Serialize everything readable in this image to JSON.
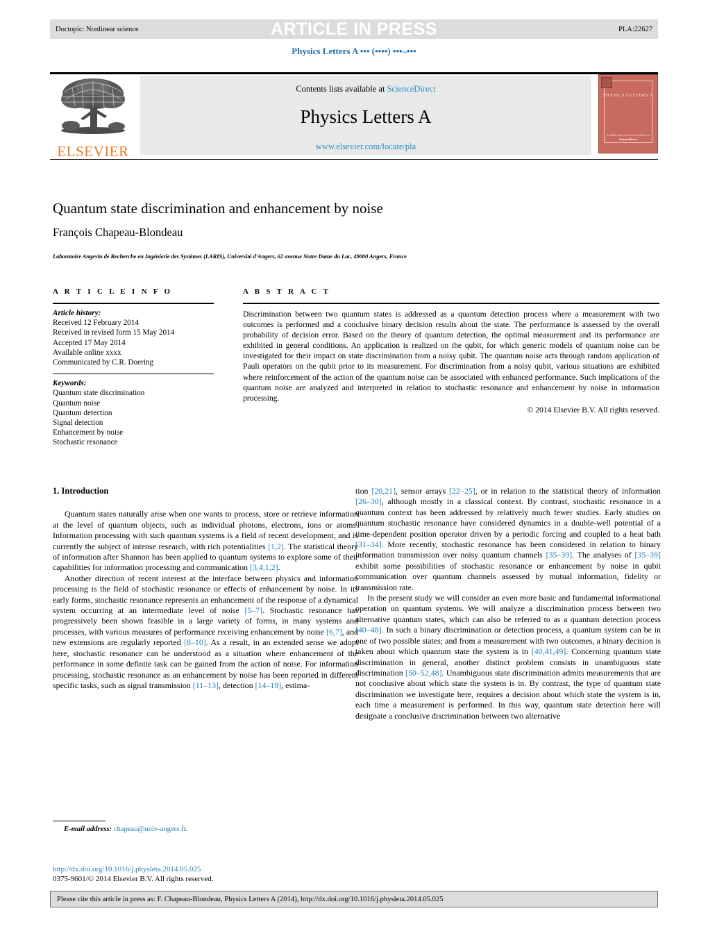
{
  "header": {
    "doctopic": "Doctopic: Nonlinear science",
    "banner": "ARTICLE IN PRESS",
    "article_code": "PLA:22627",
    "journal_ref": "Physics Letters A ••• (••••) •••–•••"
  },
  "masthead": {
    "publisher": "ELSEVIER",
    "contents_prefix": "Contents lists available at",
    "contents_link": "ScienceDirect",
    "journal_title": "Physics Letters A",
    "journal_url": "www.elsevier.com/locate/pla",
    "cover_title": "PHYSICS LETTERS A",
    "cover_footer_small": "Available online at www.sciencedirect.com",
    "cover_footer_bold": "ScienceDirect"
  },
  "title_block": {
    "title": "Quantum state discrimination and enhancement by noise",
    "author": "François Chapeau-Blondeau",
    "affiliation": "Laboratoire Angevin de Recherche en Ingénierie des Systèmes (LARIS), Université d'Angers, 62 avenue Notre Dame du Lac, 49000 Angers, France"
  },
  "article_info": {
    "heading": "A R T I C L E    I N F O",
    "history_label": "Article history:",
    "history": [
      "Received 12 February 2014",
      "Received in revised form 15 May 2014",
      "Accepted 17 May 2014",
      "Available online xxxx",
      "Communicated by C.R. Doering"
    ],
    "keywords_label": "Keywords:",
    "keywords": [
      "Quantum state discrimination",
      "Quantum noise",
      "Quantum detection",
      "Signal detection",
      "Enhancement by noise",
      "Stochastic resonance"
    ]
  },
  "abstract": {
    "heading": "A B S T R A C T",
    "text": "Discrimination between two quantum states is addressed as a quantum detection process where a measurement with two outcomes is performed and a conclusive binary decision results about the state. The performance is assessed by the overall probability of decision error. Based on the theory of quantum detection, the optimal measurement and its performance are exhibited in general conditions. An application is realized on the qubit, for which generic models of quantum noise can be investigated for their impact on state discrimination from a noisy qubit. The quantum noise acts through random application of Pauli operators on the qubit prior to its measurement. For discrimination from a noisy qubit, various situations are exhibited where reinforcement of the action of the quantum noise can be associated with enhanced performance. Such implications of the quantum noise are analyzed and interpreted in relation to stochastic resonance and enhancement by noise in information processing.",
    "copyright": "© 2014 Elsevier B.V. All rights reserved."
  },
  "body": {
    "section_title": "1. Introduction",
    "left_paragraphs": [
      "Quantum states naturally arise when one wants to process, store or retrieve information at the level of quantum objects, such as individual photons, electrons, ions or atoms. Information processing with such quantum systems is a field of recent development, and is currently the subject of intense research, with rich potentialities [1,2]. The statistical theory of information after Shannon has been applied to quantum systems to explore some of their capabilities for information processing and communication [3,4,1,2].",
      "Another direction of recent interest at the interface between physics and information processing is the field of stochastic resonance or effects of enhancement by noise. In its early forms, stochastic resonance represents an enhancement of the response of a dynamical system occurring at an intermediate level of noise [5–7]. Stochastic resonance has progressively been shown feasible in a large variety of forms, in many systems and processes, with various measures of performance receiving enhancement by noise [6,7], and new extensions are regularly reported [8–10]. As a result, in an extended sense we adopt here, stochastic resonance can be understood as a situation where enhancement of the performance in some definite task can be gained from the action of noise. For information processing, stochastic resonance as an enhancement by noise has been reported in different specific tasks, such as signal transmission [11–13], detection [14–19], estima-"
    ],
    "right_paragraphs": [
      "tion [20,21], sensor arrays [22–25], or in relation to the statistical theory of information [26–30], although mostly in a classical context. By contrast, stochastic resonance in a quantum context has been addressed by relatively much fewer studies. Early studies on quantum stochastic resonance have considered dynamics in a double-well potential of a time-dependent position operator driven by a periodic forcing and coupled to a heat bath [31–34]. More recently, stochastic resonance has been considered in relation to binary information transmission over noisy quantum channels [35–39]. The analyses of [35–39] exhibit some possibilities of stochastic resonance or enhancement by noise in qubit communication over quantum channels assessed by mutual information, fidelity or transmission rate.",
      "In the present study we will consider an even more basic and fundamental informational operation on quantum systems. We will analyze a discrimination process between two alternative quantum states, which can also be referred to as a quantum detection process [40–48]. In such a binary discrimination or detection process, a quantum system can be in one of two possible states; and from a measurement with two outcomes, a binary decision is taken about which quantum state the system is in [40,41,49]. Concerning quantum state discrimination in general, another distinct problem consists in unambiguous state discrimination [50–52,48]. Unambiguous state discrimination admits measurements that are not conclusive about which state the system is in. By contrast, the type of quantum state discrimination we investigate here, requires a decision about which state the system is in, each time a measurement is performed. In this way, quantum state detection here will designate a conclusive discrimination between two alternative"
    ]
  },
  "footnote": {
    "email_label": "E-mail address:",
    "email": "chapeau@univ-angers.fr",
    "email_trailing": ".",
    "doi": "http://dx.doi.org/10.1016/j.physleta.2014.05.025",
    "issn_line": "0375-9601/© 2014 Elsevier B.V. All rights reserved."
  },
  "cite_bar": {
    "text": "Please cite this article in press as: F. Chapeau-Blondeau, Physics Letters A (2014), http://dx.doi.org/10.1016/j.physleta.2014.05.025"
  },
  "colors": {
    "link_blue": "#2b8fc4",
    "ref_blue": "#1f7fb5",
    "elsevier_orange": "#e87722",
    "cover_red": "#c96a60",
    "bar_gray": "#dcdcdc"
  }
}
